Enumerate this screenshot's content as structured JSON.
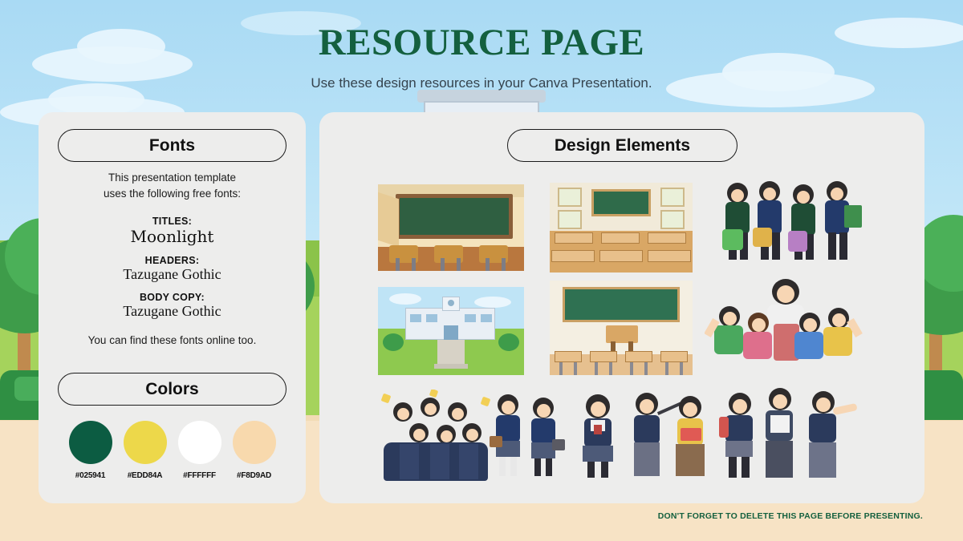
{
  "header": {
    "title": "RESOURCE PAGE",
    "subtitle": "Use these design resources in your Canva Presentation."
  },
  "fonts_card": {
    "pill_label": "Fonts",
    "intro_line1": "This presentation template",
    "intro_line2": "uses the following free fonts:",
    "entries": [
      {
        "label": "TITLES:",
        "name": "Moonlight"
      },
      {
        "label": "HEADERS:",
        "name": "Tazugane Gothic"
      },
      {
        "label": "BODY COPY:",
        "name": "Tazugane Gothic"
      }
    ],
    "footer": "You can find these fonts online too."
  },
  "colors_card": {
    "pill_label": "Colors",
    "swatches": [
      {
        "hex_label": "#025941",
        "hex": "#0c5c42"
      },
      {
        "hex_label": "#EDD84A",
        "hex": "#edd84a"
      },
      {
        "hex_label": "#FFFFFF",
        "hex": "#ffffff"
      },
      {
        "hex_label": "#F8D9AD",
        "hex": "#f8d9ad"
      }
    ]
  },
  "elements_card": {
    "pill_label": "Design Elements",
    "items": [
      {
        "name": "classroom-interior-chalkboard"
      },
      {
        "name": "classroom-desks-rows"
      },
      {
        "name": "students-walking-with-suitcases"
      },
      {
        "name": "school-building-exterior"
      },
      {
        "name": "empty-classroom-green-board"
      },
      {
        "name": "teacher-with-cheering-kids"
      },
      {
        "name": "graduating-students-crowd"
      },
      {
        "name": "two-students-walking"
      },
      {
        "name": "student-girl-standing"
      },
      {
        "name": "teacher-pair-pointer-and-book"
      },
      {
        "name": "three-students-group"
      }
    ]
  },
  "footnote": "DON'T FORGET TO DELETE THIS PAGE BEFORE PRESENTING."
}
